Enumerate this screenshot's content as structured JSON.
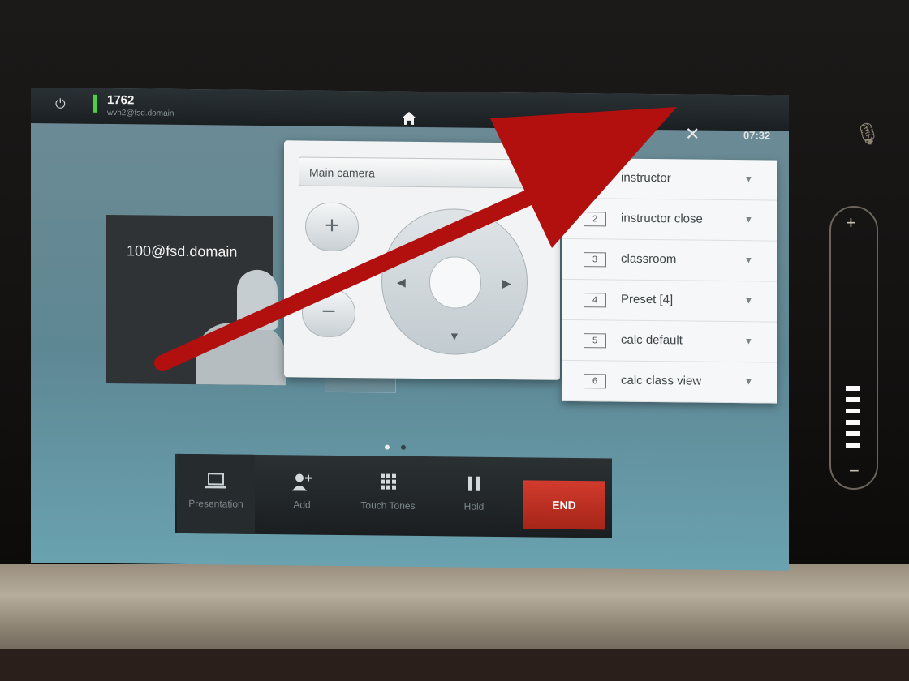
{
  "status_bar": {
    "system_number": "1762",
    "system_uri": "wvh2@fsd.domain",
    "clock": "07:32",
    "home_icon": "home-icon",
    "tools_icon": "wrench-icon",
    "power_icon": "power-icon"
  },
  "call": {
    "remote_uri": "100@fsd.domain"
  },
  "camera_panel": {
    "camera_select_value": "Main camera",
    "zoom_in_glyph": "+",
    "zoom_out_glyph": "−"
  },
  "presets": [
    {
      "num": "",
      "name": "instructor"
    },
    {
      "num": "2",
      "name": "instructor close"
    },
    {
      "num": "3",
      "name": "classroom"
    },
    {
      "num": "4",
      "name": "Preset [4]"
    },
    {
      "num": "5",
      "name": "calc default"
    },
    {
      "num": "6",
      "name": "calc class view"
    }
  ],
  "toolbar": {
    "presentation_label": "Presentation",
    "add_label": "Add",
    "touch_tones_label": "Touch Tones",
    "hold_label": "Hold",
    "end_label": "END"
  },
  "volume": {
    "plus_glyph": "+",
    "minus_glyph": "−",
    "level": 6
  },
  "colors": {
    "end_button": "#c23124",
    "signal_indicator": "#4fd043",
    "annotation_arrow": "#b20f0f"
  }
}
